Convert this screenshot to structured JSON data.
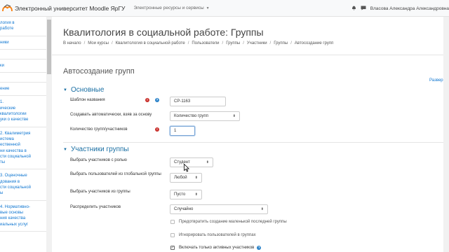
{
  "navbar": {
    "brand": "Электронный университет Moodle ЯрГУ",
    "menu_label": "Электронные ресурсы и сервисы",
    "user_name": "Власова Александра Александровна"
  },
  "drawer": {
    "items": [
      "логия в\nработе",
      "ники",
      "",
      "ки",
      "",
      "ение",
      "1.\nические\nквалитологии\nуки о качестве",
      "2. Квалиметрия\nистема\nественной\nни качества в\nсти социальной\nты",
      "3. Оценочные\nдования в\nсти социальной\nы",
      "4. Нормативно-\nвые основы\nния качества\nиальных услуг"
    ]
  },
  "page": {
    "title": "Квалитология в социальной работе: Группы",
    "breadcrumb": [
      "В начало",
      "Мои курсы",
      "Квалитология в социальной работе",
      "Пользователи",
      "Группы",
      "Участники",
      "Группы",
      "Автосоздание групп"
    ],
    "section_title": "Автосоздание групп",
    "expand_all": "Разверн"
  },
  "form": {
    "general_legend": "Основные",
    "naming_scheme_label": "Шаблон названия",
    "naming_scheme_value": "СР-1163",
    "create_by_label": "Создавать автоматически, взяв за основу",
    "create_by_value": "Количество групп",
    "count_label": "Количество групп/участников",
    "count_value": "1",
    "members_legend": "Участники группы",
    "role_label": "Выбрать участников с ролью",
    "role_value": "Студент",
    "cohort_label": "Выбрать пользователей из глобальной группы",
    "cohort_value": "Любой",
    "grouping_label": "Выбрать участников из группы",
    "grouping_value": "Пусто",
    "allocate_label": "Распределить участников",
    "allocate_value": "Случайно",
    "nosmall_label": "Предотвратить создание маленькой последней группы",
    "nosmall_checked": false,
    "notingroup_label": "Игнорировать пользователей в группах",
    "notingroup_checked": false,
    "active_label": "Включать только активных участников",
    "active_checked": true
  },
  "colors": {
    "accent": "#1177d1",
    "legend": "#1a6fa3",
    "required": "#c9302c",
    "help": "#2c83c9"
  },
  "icons": {
    "brand": "moodle-logo-icon",
    "bell": "bell-icon",
    "chat": "chat-icon",
    "required": "required-icon",
    "help": "help-icon",
    "select_arrow": "chevron-down-icon"
  }
}
